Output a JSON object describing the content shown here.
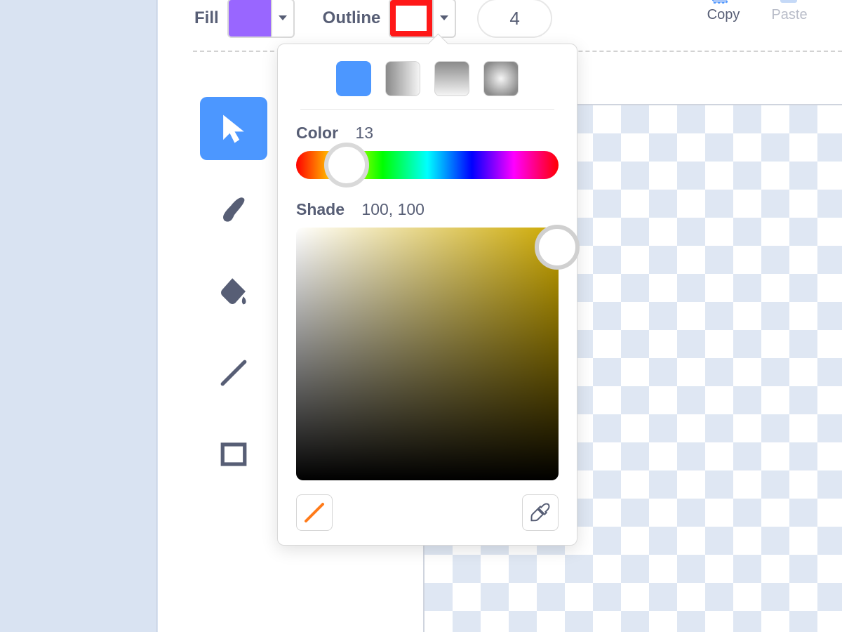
{
  "toolbar": {
    "fill_label": "Fill",
    "outline_label": "Outline",
    "stroke_width": "4",
    "fill_color": "#9966FF",
    "outline_color": "#ff1818"
  },
  "actions": {
    "copy_label": "Copy",
    "paste_label": "Paste"
  },
  "picker": {
    "color_label": "Color",
    "color_value": "13",
    "shade_label": "Shade",
    "shade_value": "100, 100"
  }
}
